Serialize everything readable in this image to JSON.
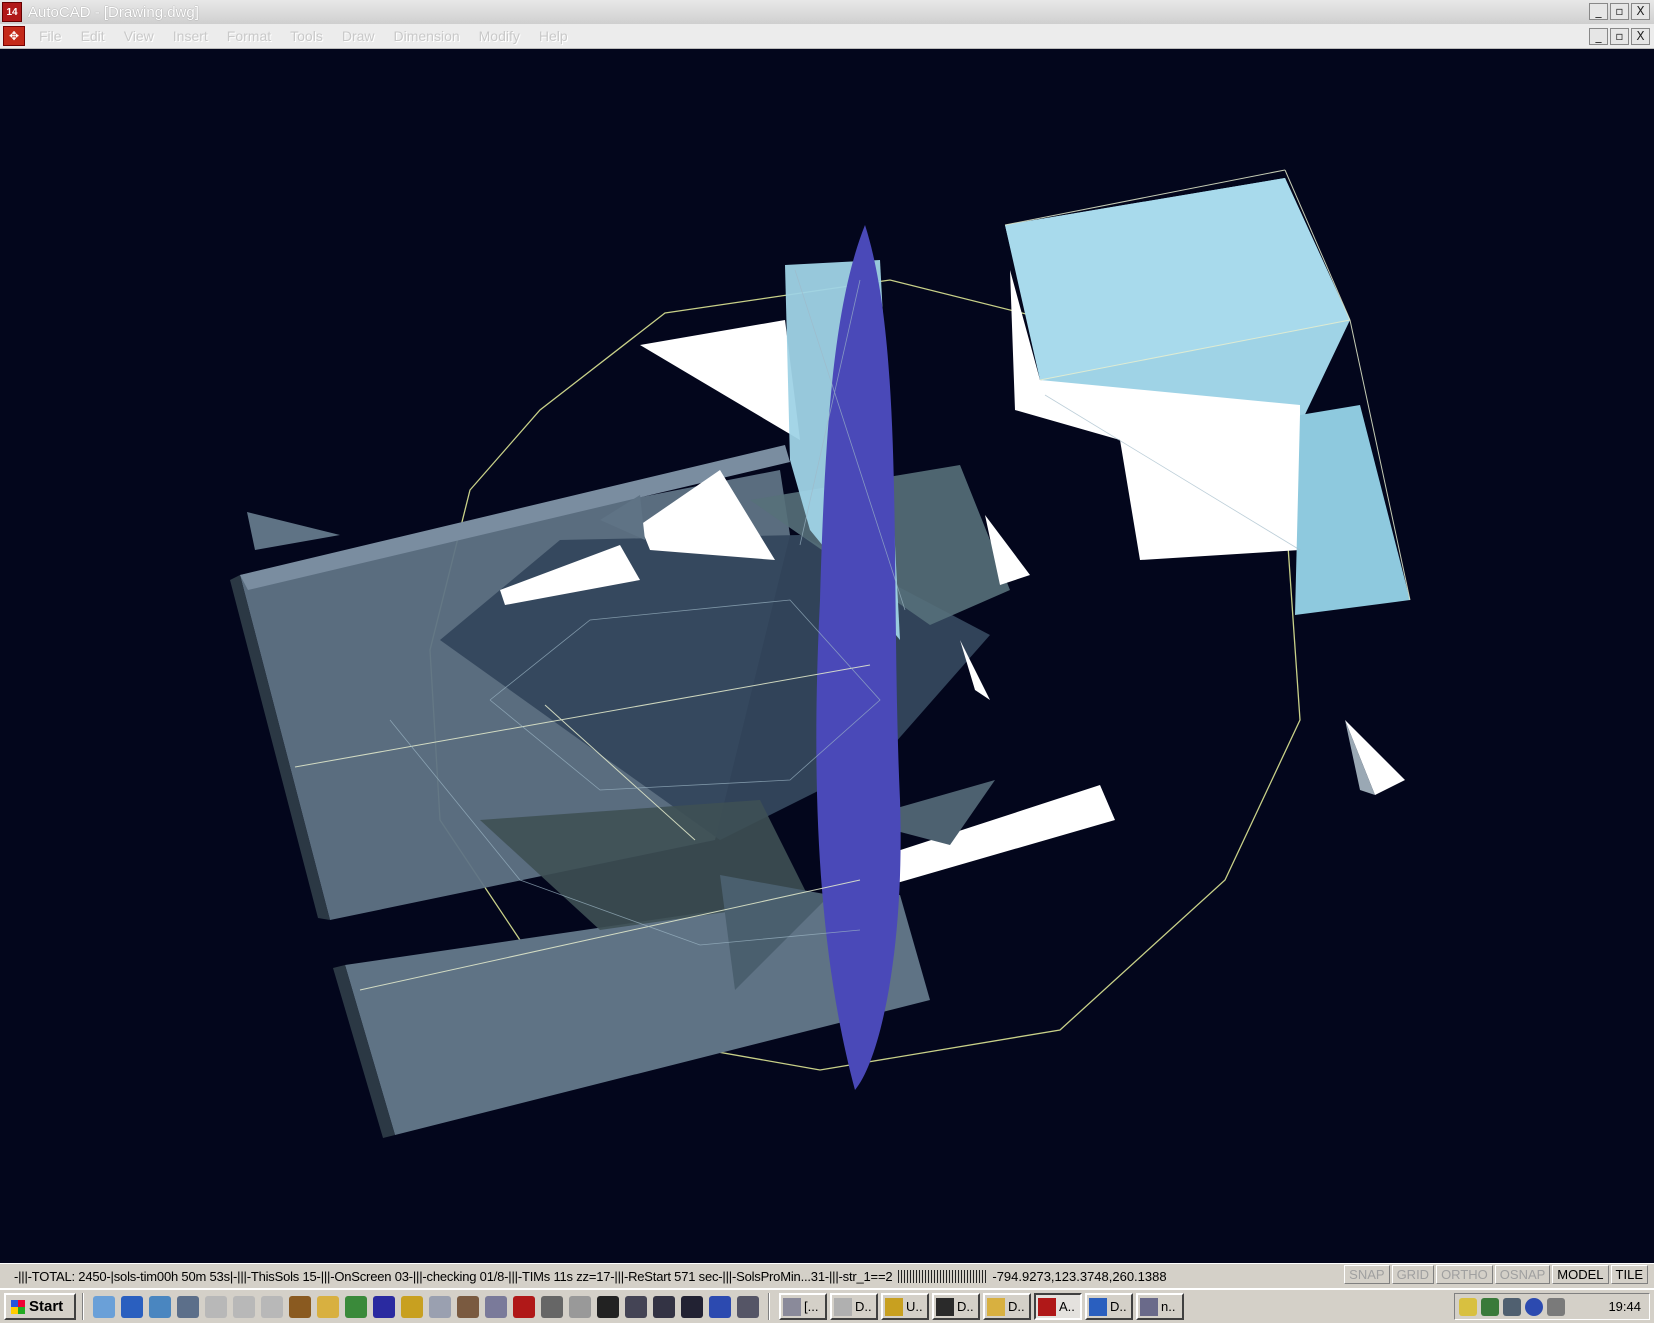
{
  "window": {
    "title": "AutoCAD - [Drawing.dwg]",
    "app_icon": "14",
    "buttons": [
      "_",
      "▫",
      "X"
    ]
  },
  "menu": {
    "items": [
      "File",
      "Edit",
      "View",
      "Insert",
      "Format",
      "Tools",
      "Draw",
      "Dimension",
      "Modify",
      "Help"
    ]
  },
  "statusbar": {
    "text": "-|||-TOTAL: 2450-|sols-tim00h 50m 53s|-|||-ThisSols 15-|||-OnScreen 03-|||-checking 01/8-|||-TIMs 11s zz=17-|||-ReStart 571 sec-|||-SolsProMin...31-|||-str_1==2",
    "coordinates": "-794.9273,123.3748,260.1388",
    "modes": [
      {
        "label": "SNAP",
        "on": false
      },
      {
        "label": "GRID",
        "on": false
      },
      {
        "label": "ORTHO",
        "on": false
      },
      {
        "label": "OSNAP",
        "on": false
      },
      {
        "label": "MODEL",
        "on": true
      },
      {
        "label": "TILE",
        "on": true
      }
    ]
  },
  "taskbar": {
    "start_label": "Start",
    "quicklaunch": [
      "notepad-icon",
      "ie-icon",
      "network-icon",
      "monitor-icon",
      "drive-icon",
      "drive-icon",
      "drive-icon",
      "tree-icon",
      "folder-icon",
      "tools-icon",
      "media-icon",
      "app-icon",
      "document-icon",
      "settings-icon",
      "computer-icon",
      "autocad-icon",
      "move-icon",
      "shape-icon",
      "terminal-icon",
      "grid-icon",
      "cursor-icon",
      "pointer-icon",
      "eye-icon",
      "bars-icon"
    ],
    "tasks": [
      {
        "label": "[...",
        "icon": "window-icon"
      },
      {
        "label": "D..",
        "icon": "drive-icon"
      },
      {
        "label": "U..",
        "icon": "app-icon"
      },
      {
        "label": "D..",
        "icon": "nvidia-icon"
      },
      {
        "label": "D..",
        "icon": "folder-icon"
      },
      {
        "label": "A..",
        "icon": "autocad-icon",
        "active": true
      },
      {
        "label": "D..",
        "icon": "ie-icon"
      },
      {
        "label": "n..",
        "icon": "network-icon"
      }
    ],
    "clock": "19:44"
  },
  "colors": {
    "viewport_bg": "#03061c",
    "light_blue_solid": "#9fd3e6",
    "white_solid": "#ffffff",
    "slate_solid": "#5f7385",
    "violet_blade": "#4a49b8",
    "wire_green": "#c8d088"
  }
}
